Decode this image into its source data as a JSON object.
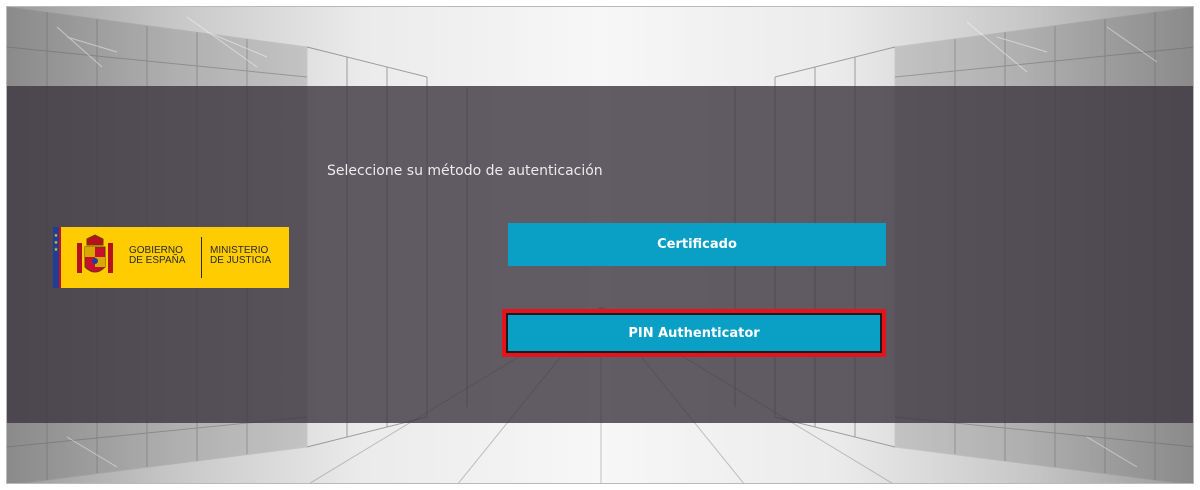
{
  "page": {
    "prompt": "Seleccione su método de autenticación"
  },
  "logo": {
    "gov_text": "GOBIERNO\nDE ESPAÑA",
    "ministry_text": "MINISTERIO\nDE JUSTICIA"
  },
  "auth_options": {
    "certificate_label": "Certificado",
    "pin_label": "PIN Authenticator"
  },
  "colors": {
    "button_bg": "#0aa0c6",
    "highlight_border": "#e3141b",
    "overlay": "#3c343e",
    "logo_yellow": "#fecc00"
  }
}
